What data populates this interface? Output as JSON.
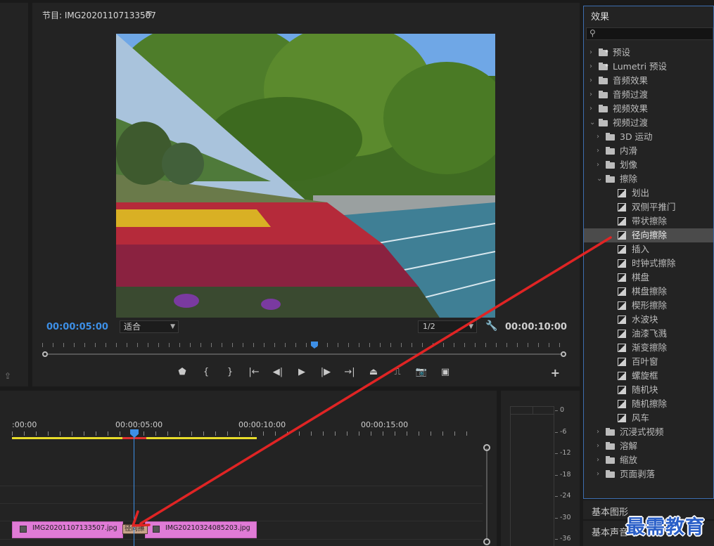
{
  "monitor": {
    "title": "节目: IMG20201107133507",
    "menu_icon": "hamburger-icon",
    "timecode_current": "00:00:05:00",
    "fit_value": "适合",
    "resolution_value": "1/2",
    "timecode_duration": "00:00:10:00",
    "transport_icons": [
      "add-marker-icon",
      "mark-in-icon",
      "mark-out-icon",
      "go-to-in-icon",
      "step-back-icon",
      "play-icon",
      "step-forward-icon",
      "go-to-out-icon",
      "lift-icon",
      "extract-icon",
      "export-frame-icon",
      "comparison-view-icon"
    ],
    "transport_glyphs": [
      "⬟",
      "{",
      "}",
      "|←",
      "◀|",
      "▶",
      "|▶",
      "→|",
      "⏏",
      "⎍",
      "📷",
      "▣"
    ],
    "add_button_label": "+",
    "accent_color": "#3d8fe6"
  },
  "effects": {
    "title": "效果",
    "search_placeholder": "",
    "tree": [
      {
        "label": "预设",
        "level": 0,
        "type": "folder-star",
        "expanded": false
      },
      {
        "label": "Lumetri 预设",
        "level": 0,
        "type": "folder-star",
        "expanded": false
      },
      {
        "label": "音频效果",
        "level": 0,
        "type": "folder",
        "expanded": false
      },
      {
        "label": "音频过渡",
        "level": 0,
        "type": "folder",
        "expanded": false
      },
      {
        "label": "视频效果",
        "level": 0,
        "type": "folder",
        "expanded": false
      },
      {
        "label": "视频过渡",
        "level": 0,
        "type": "folder",
        "expanded": true
      },
      {
        "label": "3D 运动",
        "level": 1,
        "type": "folder",
        "expanded": false
      },
      {
        "label": "内滑",
        "level": 1,
        "type": "folder",
        "expanded": false
      },
      {
        "label": "划像",
        "level": 1,
        "type": "folder",
        "expanded": false
      },
      {
        "label": "擦除",
        "level": 1,
        "type": "folder",
        "expanded": true
      },
      {
        "label": "划出",
        "level": 2,
        "type": "effect"
      },
      {
        "label": "双侧平推门",
        "level": 2,
        "type": "effect"
      },
      {
        "label": "带状擦除",
        "level": 2,
        "type": "effect"
      },
      {
        "label": "径向擦除",
        "level": 2,
        "type": "effect",
        "selected": true
      },
      {
        "label": "插入",
        "level": 2,
        "type": "effect"
      },
      {
        "label": "时钟式擦除",
        "level": 2,
        "type": "effect"
      },
      {
        "label": "棋盘",
        "level": 2,
        "type": "effect"
      },
      {
        "label": "棋盘擦除",
        "level": 2,
        "type": "effect"
      },
      {
        "label": "楔形擦除",
        "level": 2,
        "type": "effect"
      },
      {
        "label": "水波块",
        "level": 2,
        "type": "effect"
      },
      {
        "label": "油漆飞溅",
        "level": 2,
        "type": "effect"
      },
      {
        "label": "渐变擦除",
        "level": 2,
        "type": "effect"
      },
      {
        "label": "百叶窗",
        "level": 2,
        "type": "effect"
      },
      {
        "label": "螺旋框",
        "level": 2,
        "type": "effect"
      },
      {
        "label": "随机块",
        "level": 2,
        "type": "effect"
      },
      {
        "label": "随机擦除",
        "level": 2,
        "type": "effect"
      },
      {
        "label": "风车",
        "level": 2,
        "type": "effect"
      },
      {
        "label": "沉浸式视频",
        "level": 1,
        "type": "folder",
        "expanded": false
      },
      {
        "label": "溶解",
        "level": 1,
        "type": "folder",
        "expanded": false
      },
      {
        "label": "缩放",
        "level": 1,
        "type": "folder",
        "expanded": false
      },
      {
        "label": "页面剥落",
        "level": 1,
        "type": "folder",
        "expanded": false
      }
    ]
  },
  "panels": {
    "basic_graphics": "基本图形",
    "basic_sound": "基本声音"
  },
  "timeline": {
    "ruler_labels": [
      ":00:00",
      "00:00:05:00",
      "00:00:10:00",
      "00:00:15:00"
    ],
    "clips": [
      {
        "name": "IMG20201107133507.jpg",
        "color": "#e07bd6"
      },
      {
        "name": "IMG20210324085203.jpg",
        "color": "#e07bd6"
      }
    ],
    "transition_label": "径向擦",
    "work_area_color": "#e8dd2a"
  },
  "meter": {
    "labels": [
      "0",
      "-6",
      "-12",
      "-18",
      "-24",
      "-30",
      "-36"
    ]
  },
  "watermark": "最需教育",
  "annotation_color": "#e02424"
}
